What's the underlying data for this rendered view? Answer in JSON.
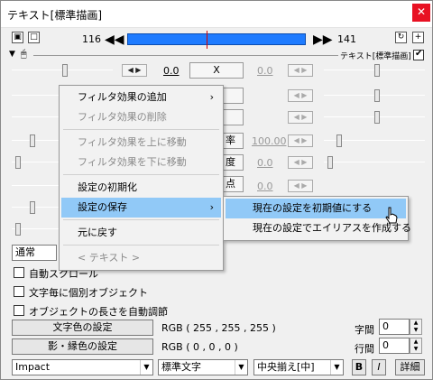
{
  "window": {
    "title": "テキスト[標準描画]",
    "close_glyph": "✕"
  },
  "toolbar": {
    "frame_start": "116",
    "frame_end": "141",
    "prev_glyph": "◀◀",
    "next_glyph": "▶▶",
    "object_label": "テキスト[標準描画]",
    "object_checked": true,
    "plus_glyph": "+",
    "accent_color": "#1e7bff"
  },
  "params": {
    "row0_value": "0.0",
    "row0_button": "X",
    "row0_right_value": "0.0",
    "percent_value": "100.00",
    "r4_value": "0.0",
    "r5_value": "0.0",
    "btn_ritsu": "率",
    "btn_do": "度",
    "btn_ten": "点"
  },
  "blend_select": "通常",
  "checkboxes": [
    {
      "label": "自動スクロール",
      "checked": false
    },
    {
      "label": "文字毎に個別オブジェクト",
      "checked": false
    },
    {
      "label": "オブジェクトの長さを自動調節",
      "checked": false
    }
  ],
  "color": {
    "text_button": "文字色の設定",
    "text_rgb": "RGB ( 255 , 255 , 255 )",
    "shadow_button": "影・縁色の設定",
    "shadow_rgb": "RGB ( 0 , 0 , 0 )"
  },
  "spacing": {
    "char_label": "字間",
    "char_value": "0",
    "line_label": "行間",
    "line_value": "0"
  },
  "font": {
    "family": "Impact",
    "style": "標準文字",
    "align": "中央揃え[中]",
    "bold": "B",
    "italic": "I",
    "detail": "詳細"
  },
  "context_menu": {
    "items": [
      {
        "label": "フィルタ効果の追加",
        "disabled": false,
        "submenu": true
      },
      {
        "label": "フィルタ効果の削除",
        "disabled": true
      },
      {
        "label": "フィルタ効果を上に移動",
        "disabled": true
      },
      {
        "label": "フィルタ効果を下に移動",
        "disabled": true
      },
      {
        "label": "設定の初期化",
        "disabled": false
      },
      {
        "label": "設定の保存",
        "disabled": false,
        "submenu": true,
        "highlighted": true
      },
      {
        "label": "元に戻す",
        "disabled": false
      },
      {
        "label": "< テキスト >",
        "disabled": true
      }
    ],
    "submenu_arrow": "›",
    "submenu": [
      {
        "label": "現在の設定を初期値にする",
        "highlighted": true
      },
      {
        "label": "現在の設定でエイリアスを作成する",
        "highlighted": false
      }
    ],
    "highlight_color": "#91c9f7"
  }
}
